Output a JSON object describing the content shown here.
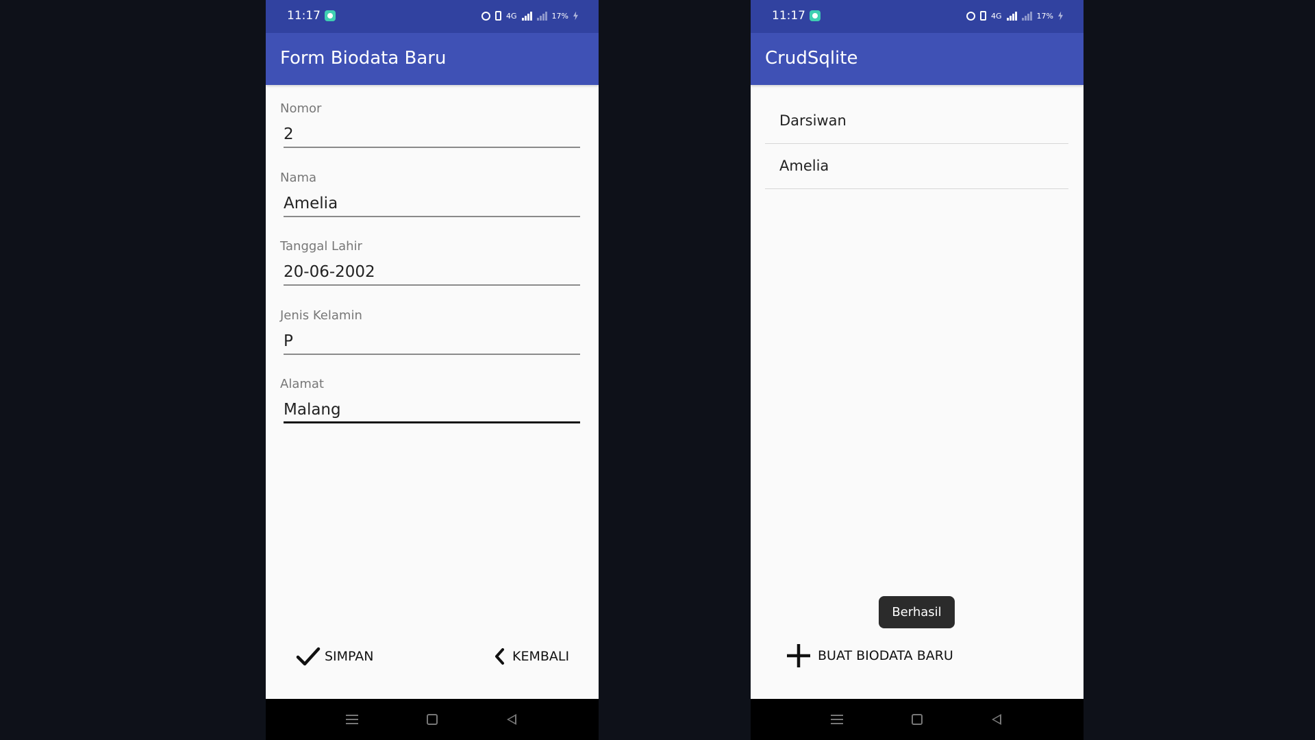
{
  "status_bar": {
    "time": "11:17",
    "network": "4G",
    "battery": "17%"
  },
  "form_screen": {
    "title": "Form Biodata Baru",
    "fields": [
      {
        "label": "Nomor",
        "value": "2"
      },
      {
        "label": "Nama",
        "value": "Amelia"
      },
      {
        "label": "Tanggal Lahir",
        "value": "20-06-2002"
      },
      {
        "label": "Jenis Kelamin",
        "value": "P"
      },
      {
        "label": "Alamat",
        "value": "Malang"
      }
    ],
    "save_label": "SIMPAN",
    "back_label": "KEMBALI"
  },
  "list_screen": {
    "title": "CrudSqlite",
    "items": [
      "Darsiwan",
      "Amelia"
    ],
    "toast": "Berhasil",
    "add_label": "BUAT BIODATA BARU"
  },
  "colors": {
    "status_bar": "#3142a0",
    "app_bar": "#3f51b5",
    "background": "#0e1119",
    "screen": "#fafafa"
  },
  "icons": [
    "alarm-icon",
    "vibrate-icon",
    "signal-icon",
    "battery-charging-icon",
    "check-icon",
    "chevron-left-icon",
    "plus-icon",
    "nav-menu-icon",
    "nav-home-icon",
    "nav-back-icon"
  ]
}
